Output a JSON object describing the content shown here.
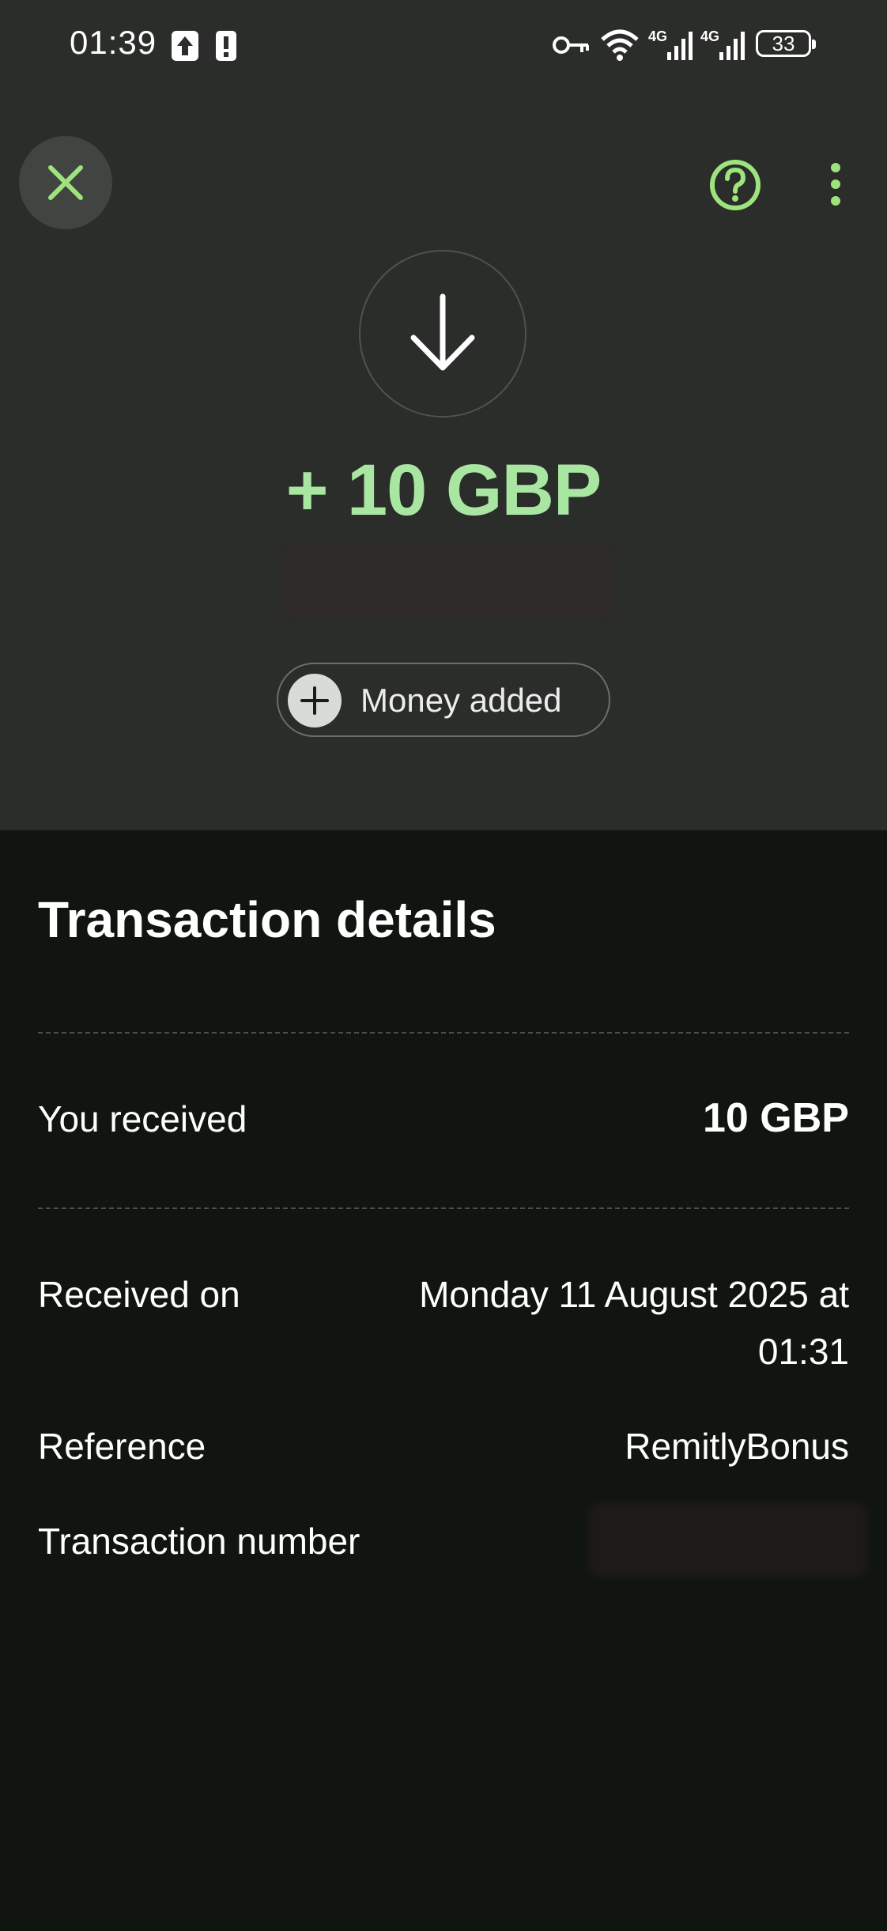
{
  "status_bar": {
    "time": "01:39",
    "network_1": "4G",
    "network_2": "4G",
    "battery": "33"
  },
  "header": {
    "close_icon": "close-icon",
    "help_icon": "help-circle-icon",
    "more_icon": "more-vertical-icon"
  },
  "hero": {
    "direction_icon": "arrow-down-icon",
    "amount": "+ 10 GBP",
    "type_label": "Money added",
    "type_icon": "plus-icon"
  },
  "details": {
    "title": "Transaction details",
    "rows": [
      {
        "label": "You received",
        "value": "10 GBP"
      },
      {
        "label": "Received on",
        "value_line1": "Monday 11 August 2025 at",
        "value_line2": "01:31"
      },
      {
        "label": "Reference",
        "value": "RemitlyBonus"
      },
      {
        "label": "Transaction number",
        "value": ""
      }
    ]
  },
  "colors": {
    "accent_green": "#a8e6a1",
    "icon_green": "#9ee37d",
    "top_background": "#2a2d29",
    "bottom_background": "#111510"
  }
}
